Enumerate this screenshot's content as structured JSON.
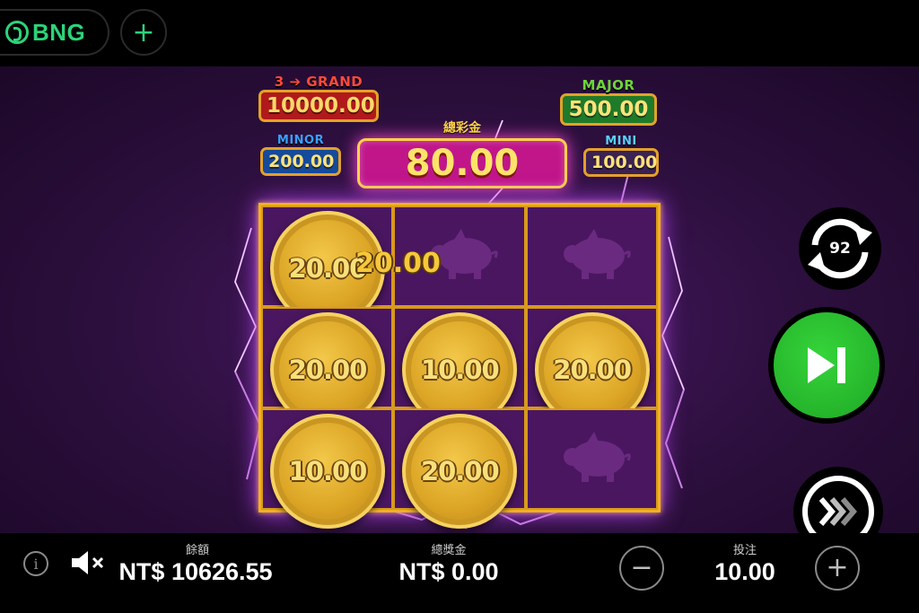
{
  "topbar": {
    "brand": "BNG",
    "add_icon": "plus-icon"
  },
  "jackpots": {
    "grand": {
      "label": "3 ➔ GRAND",
      "value": "10000.00"
    },
    "major": {
      "label": "MAJOR",
      "value": "500.00"
    },
    "minor": {
      "label": "MINOR",
      "value": "200.00"
    },
    "mini": {
      "label": "MINI",
      "value": "100.00"
    }
  },
  "total_win": {
    "label": "總彩金",
    "value": "80.00"
  },
  "floating_win": "20.00",
  "grid": {
    "cells": [
      {
        "type": "coin",
        "value": "20.00"
      },
      {
        "type": "pig",
        "value": ""
      },
      {
        "type": "pig",
        "value": ""
      },
      {
        "type": "coin",
        "value": "20.00"
      },
      {
        "type": "coin",
        "value": "10.00"
      },
      {
        "type": "coin",
        "value": "20.00"
      },
      {
        "type": "coin",
        "value": "10.00"
      },
      {
        "type": "coin",
        "value": "20.00"
      },
      {
        "type": "pig",
        "value": ""
      }
    ]
  },
  "controls": {
    "autospin_count": "92",
    "play_icon": "skip-next-icon",
    "turbo_icon": "fast-forward-icon"
  },
  "bottombar": {
    "balance_label": "餘額",
    "balance_value": "NT$ 10626.55",
    "win_label": "總獎金",
    "win_value": "NT$ 0.00",
    "bet_label": "投注",
    "bet_value": "10.00",
    "minus": "−",
    "plus": "+",
    "info": "i"
  },
  "colors": {
    "brand_green": "#2bd47a",
    "play_green": "#1ea825",
    "frame_gold": "#f2b21a",
    "total_win_bg": "#c0168a"
  }
}
